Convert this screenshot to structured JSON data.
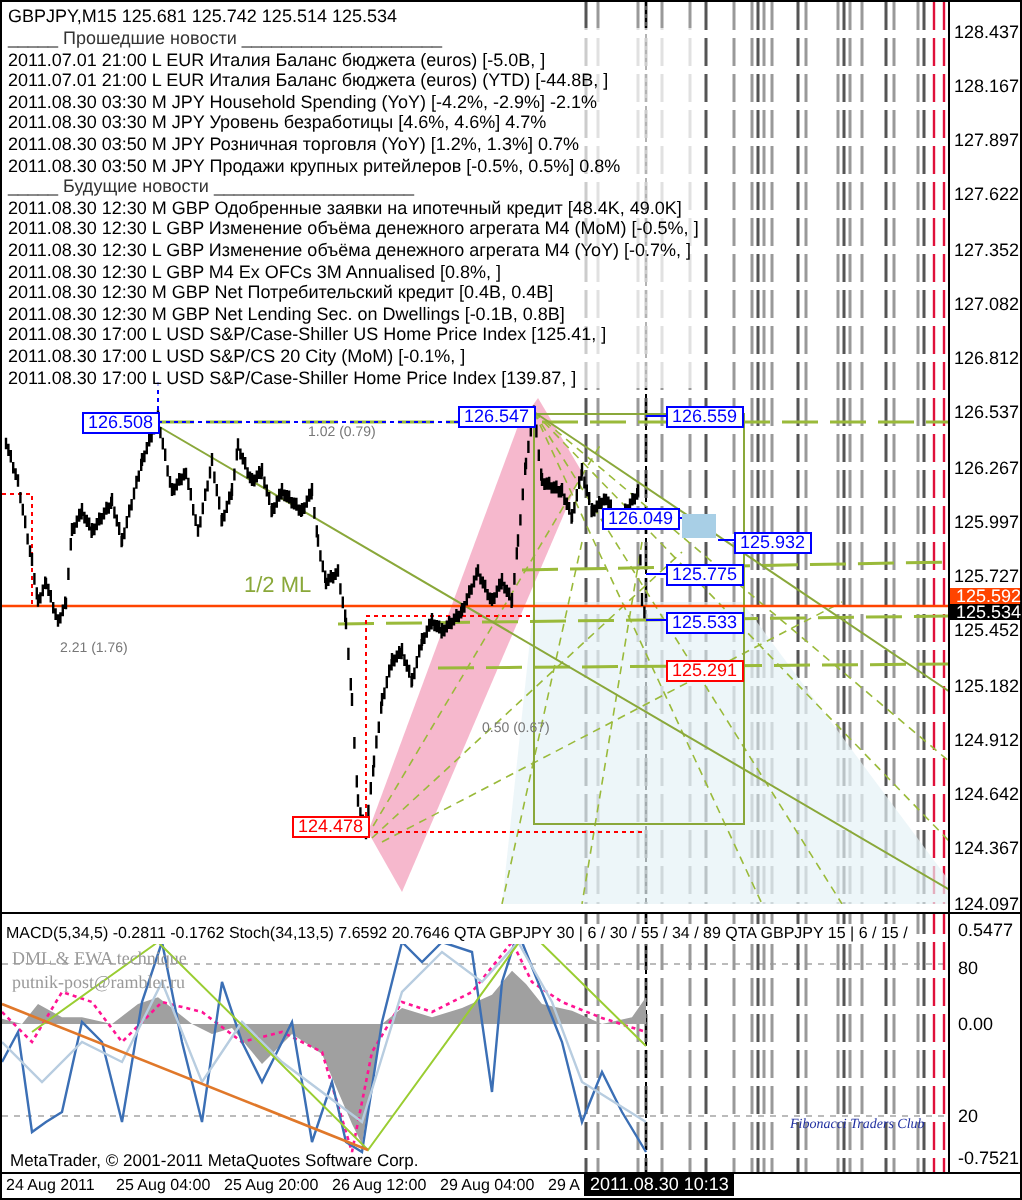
{
  "main_chart": {
    "header": "GBPJPY,M15  125.681 125.742 125.514 125.534",
    "news": [
      {
        "kind": "heading",
        "text": "_____ Прошедшие новости ____________________"
      },
      {
        "kind": "item",
        "text": "2011.07.01 21:00 L EUR Италия Баланс бюджета (euros) [-5.0B, ]"
      },
      {
        "kind": "item",
        "text": "2011.07.01 21:00 L EUR Италия Баланс бюджета (euros) (YTD) [-44.8B, ]"
      },
      {
        "kind": "item",
        "text": "2011.08.30 03:30 M JPY Household Spending (YoY) [-4.2%, -2.9%] -2.1%"
      },
      {
        "kind": "item",
        "text": "2011.08.30 03:30 M JPY Уровень безработицы [4.6%, 4.6%] 4.7%"
      },
      {
        "kind": "item",
        "text": "2011.08.30 03:50 M JPY Розничная торговля (YoY) [1.2%, 1.3%] 0.7%"
      },
      {
        "kind": "item",
        "text": "2011.08.30 03:50 M JPY Продажи крупных ритейлеров [-0.5%, 0.5%] 0.8%"
      },
      {
        "kind": "heading",
        "text": "_____ Будущие новости ____________________"
      },
      {
        "kind": "item",
        "text": "2011.08.30 12:30 M GBP Одобренные заявки на ипотечный кредит [48.4K, 49.0K]"
      },
      {
        "kind": "item",
        "text": "2011.08.30 12:30 L GBP Изменение объёма денежного агрегата M4 (MoM) [-0.5%, ]"
      },
      {
        "kind": "item",
        "text": "2011.08.30 12:30 L GBP Изменение объёма денежного агрегата M4 (YoY) [-0.7%, ]"
      },
      {
        "kind": "item",
        "text": "2011.08.30 12:30 L GBP M4 Ex OFCs 3M Annualised [0.8%, ]"
      },
      {
        "kind": "item",
        "text": "2011.08.30 12:30 M GBP Net Потребительский кредит [0.4B, 0.4B]"
      },
      {
        "kind": "item",
        "text": "2011.08.30 12:30 M GBP Net Lending Sec. on Dwellings [-0.1B, 0.8B]"
      },
      {
        "kind": "item",
        "text": "2011.08.30 17:00 L USD S&P/Case-Shiller US Home Price Index [125.41, ]"
      },
      {
        "kind": "item",
        "text": "2011.08.30 17:00 L USD S&P/CS 20 City (MoM) [-0.1%, ]"
      },
      {
        "kind": "item",
        "text": "2011.08.30 17:00 L USD S&P/Case-Shiller Home Price Index [139.87, ]"
      }
    ],
    "price_labels": [
      {
        "text": "126.508",
        "color": "#0000ff"
      },
      {
        "text": "126.547",
        "color": "#0000ff"
      },
      {
        "text": "126.559",
        "color": "#0000ff"
      },
      {
        "text": "126.049",
        "color": "#0000ff"
      },
      {
        "text": "125.932",
        "color": "#0000ff"
      },
      {
        "text": "125.775",
        "color": "#0000ff"
      },
      {
        "text": "125.533",
        "color": "#0000ff"
      },
      {
        "text": "125.291",
        "color": "#ff0000"
      },
      {
        "text": "124.478",
        "color": "#ff0000"
      }
    ],
    "annotations": [
      "1/2 ML",
      "1.02 (0.79)",
      "2.21 (1.76)",
      "0.50 (0.67)"
    ],
    "price_axis": [
      "128.437",
      "128.167",
      "127.897",
      "127.622",
      "127.352",
      "127.082",
      "126.812",
      "126.537",
      "126.267",
      "125.997",
      "125.727",
      "125.452",
      "125.182",
      "124.912",
      "124.642",
      "124.367",
      "124.097"
    ],
    "bid_tag": "125.592",
    "last_tag": "125.534"
  },
  "indicator": {
    "header": "MACD(5,34,5) -0.2811 -0.1762  Stoch(34,13,5) 7.6592 20.7646  QTA GBPJPY 30 | 6 / 30 / 55 / 34 / 89  QTA GBPJPY 15 | 6 / 15 /",
    "watermark": [
      "DML & EWA  technique",
      "putnik-post@rambler.ru"
    ],
    "copyright": "MetaTrader, © 2001-2011 MetaQuotes Software Corp.",
    "signature": "Fibonacci Traders Club",
    "axis": [
      "0.5477",
      "80",
      "0.00",
      "20",
      "-0.7521"
    ]
  },
  "time_axis": {
    "labels": [
      "24 Aug 2011",
      "25 Aug 04:00",
      "25 Aug 20:00",
      "26 Aug 12:00",
      "29 Aug 04:00",
      "29 A"
    ],
    "cursor_tag": "2011.08.30 10:13"
  }
}
